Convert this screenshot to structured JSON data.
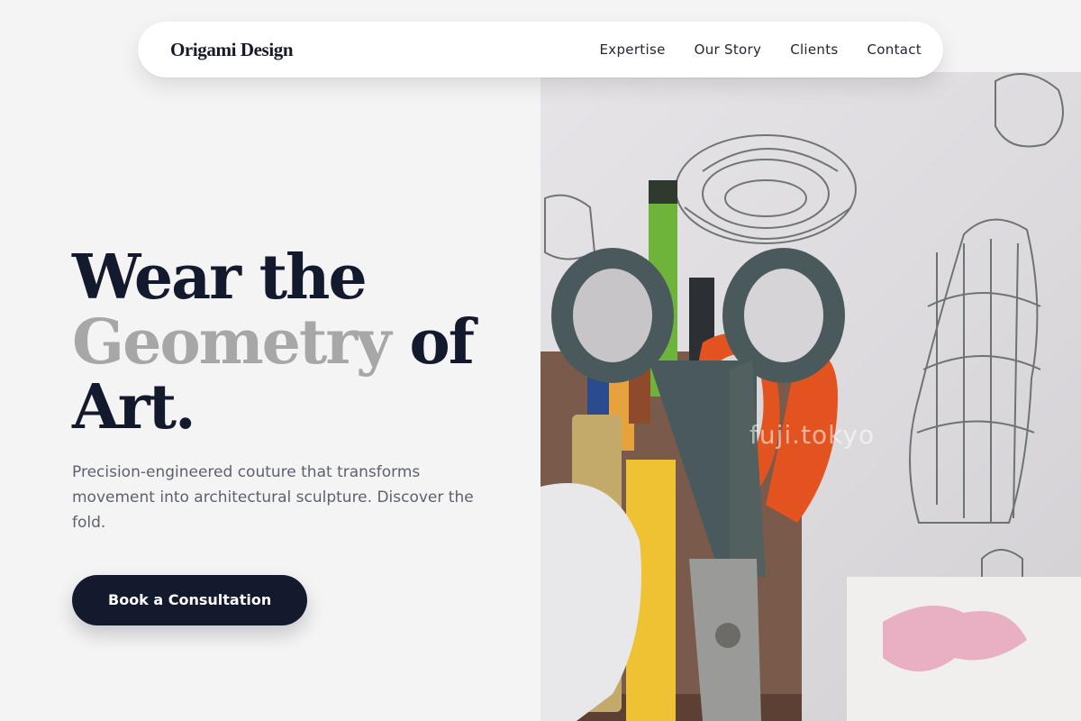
{
  "nav": {
    "brand": "Origami Design",
    "links": [
      "Expertise",
      "Our Story",
      "Clients",
      "Contact"
    ]
  },
  "hero": {
    "headline_1": "Wear the",
    "headline_2_muted": "Geometry",
    "headline_2_rest": "of",
    "headline_3": "Art.",
    "description": "Precision-engineered couture that transforms movement into architectural sculpture. Discover the fold.",
    "cta_label": "Book a Consultation"
  },
  "image": {
    "watermark": "fuji.tokyo",
    "subject": "scissors-and-pencils-photo"
  },
  "colors": {
    "background": "#f4f4f4",
    "ink": "#141a2d",
    "muted_headline": "#a7a7a7",
    "body_text": "#5c616e",
    "button": "#131a2e"
  }
}
